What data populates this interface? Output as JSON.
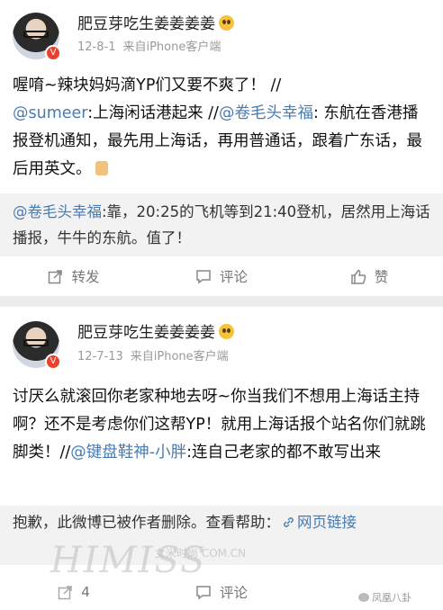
{
  "posts": [
    {
      "username": "肥豆芽吃生姜姜姜姜",
      "date": "12-8-1",
      "source": "来自iPhone客户端",
      "text_1": "喔唷~辣块妈妈滴YP们又要不爽了！ //",
      "mention_1": "@sumeer",
      "text_2": ":上海闲话港起来 //",
      "mention_2": "@卷毛头幸福",
      "text_3": ": 东航在香港播报登机通知，最先用上海话，再用普通话，跟着广东话，最后用英文。",
      "quote_mention": "@卷毛头幸福",
      "quote_text": ":靠，20:25的飞机等到21:40登机，居然用上海话播报，牛牛的东航。值了！",
      "actions": {
        "repost": "转发",
        "comment": "评论",
        "like": "赞"
      }
    },
    {
      "username": "肥豆芽吃生姜姜姜姜",
      "date": "12-7-13",
      "source": "来自iPhone客户端",
      "text_1": "讨厌么就滚回你老家种地去呀~你当我们不想用上海话主持啊？还不是考虑你们这帮YP！就用上海话报个站名你们就跳脚类！//",
      "mention_1": "@键盘鞋神-小胖",
      "text_2": ":连自己老家的都不敢写出来",
      "quote_text": "抱歉，此微博已被作者删除。查看帮助：",
      "quote_link": "网页链接",
      "actions": {
        "repost": "4",
        "comment": "评论"
      }
    }
  ],
  "watermark": "HIMISS",
  "watermark_sub": "女米时尚 COM.CN",
  "source_label": "凤凰八卦",
  "icons": {
    "repost": "share-box-icon",
    "comment": "speech-bubble-icon",
    "like": "thumbs-up-icon",
    "verified": "v-badge-icon",
    "emoji": "emoji-face-icon",
    "link": "link-icon"
  },
  "colors": {
    "link": "#4a7bb0",
    "badge": "#e8412c",
    "meta": "#9a9a9a",
    "action": "#777777"
  }
}
